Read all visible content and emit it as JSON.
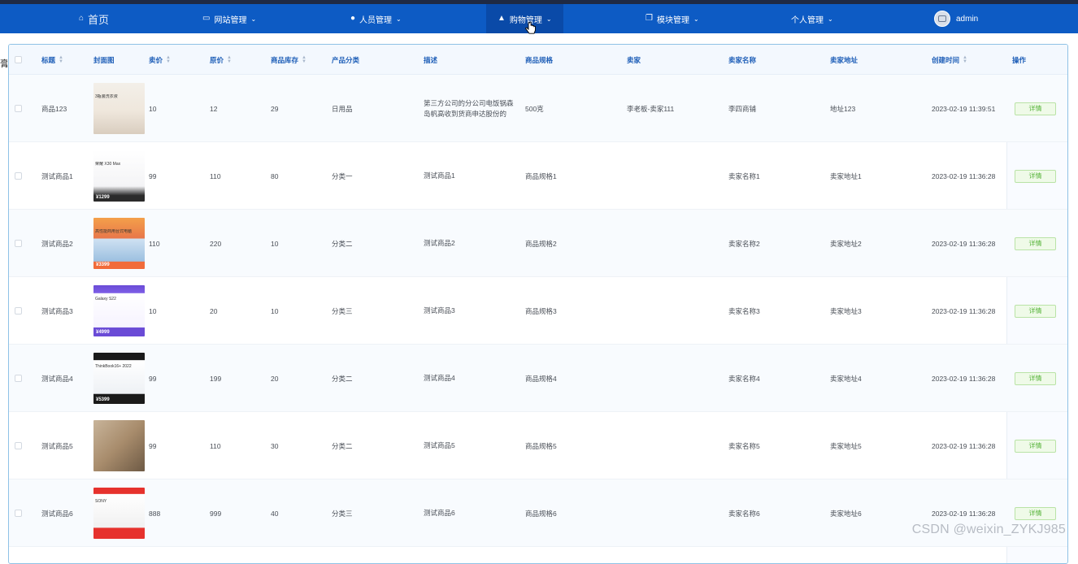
{
  "nav": {
    "home": "首页",
    "items": [
      {
        "label": "网站管理",
        "icon": "monitor-icon"
      },
      {
        "label": "人员管理",
        "icon": "user-icon"
      },
      {
        "label": "购物管理",
        "icon": "bag-icon"
      },
      {
        "label": "模块管理",
        "icon": "copy-icon"
      },
      {
        "label": "个人管理",
        "icon": ""
      }
    ],
    "user": "admin"
  },
  "left_char": "膏",
  "table": {
    "headers": [
      "标题",
      "封面图",
      "卖价",
      "原价",
      "商品库存",
      "产品分类",
      "描述",
      "商品规格",
      "卖家",
      "卖家名称",
      "卖家地址",
      "创建时间",
      "操作"
    ],
    "detail_label": "详情",
    "rows": [
      {
        "title": "商品123",
        "price": "10",
        "orig": "12",
        "stock": "29",
        "category": "日用品",
        "desc": "第三方公司的分公司电饭锅森岛帆高收到货商申达股份的",
        "spec": "500克",
        "seller": "李老板-卖家111",
        "seller_name": "李四商铺",
        "address": "地址123",
        "created": "2023-02-19 11:39:51"
      },
      {
        "title": "测试商品1",
        "price": "99",
        "orig": "110",
        "stock": "80",
        "category": "分类一",
        "desc": "测试商品1",
        "spec": "商品规格1",
        "seller": "",
        "seller_name": "卖家名称1",
        "address": "卖家地址1",
        "created": "2023-02-19 11:36:28"
      },
      {
        "title": "测试商品2",
        "price": "110",
        "orig": "220",
        "stock": "10",
        "category": "分类二",
        "desc": "测试商品2",
        "spec": "商品规格2",
        "seller": "",
        "seller_name": "卖家名称2",
        "address": "卖家地址2",
        "created": "2023-02-19 11:36:28"
      },
      {
        "title": "测试商品3",
        "price": "10",
        "orig": "20",
        "stock": "10",
        "category": "分类三",
        "desc": "测试商品3",
        "spec": "商品规格3",
        "seller": "",
        "seller_name": "卖家名称3",
        "address": "卖家地址3",
        "created": "2023-02-19 11:36:28"
      },
      {
        "title": "测试商品4",
        "price": "99",
        "orig": "199",
        "stock": "20",
        "category": "分类二",
        "desc": "测试商品4",
        "spec": "商品规格4",
        "seller": "",
        "seller_name": "卖家名称4",
        "address": "卖家地址4",
        "created": "2023-02-19 11:36:28"
      },
      {
        "title": "测试商品5",
        "price": "99",
        "orig": "110",
        "stock": "30",
        "category": "分类二",
        "desc": "测试商品5",
        "spec": "商品规格5",
        "seller": "",
        "seller_name": "卖家名称5",
        "address": "卖家地址5",
        "created": "2023-02-19 11:36:28"
      },
      {
        "title": "测试商品6",
        "price": "888",
        "orig": "999",
        "stock": "40",
        "category": "分类三",
        "desc": "测试商品6",
        "spec": "商品规格6",
        "seller": "",
        "seller_name": "卖家名称6",
        "address": "卖家地址6",
        "created": "2023-02-19 11:36:28"
      }
    ],
    "thumbs": [
      {
        "caption": "3瓶装洗衣液",
        "price_tag": ""
      },
      {
        "caption": "荣耀 X30 Max",
        "price_tag": "1299"
      },
      {
        "caption": "高性能商用台式电脑",
        "price_tag": "3399"
      },
      {
        "caption": "Galaxy S22",
        "price_tag": "4999"
      },
      {
        "caption": "ThinkBook16+ 2022",
        "price_tag": "5399"
      },
      {
        "caption": "",
        "price_tag": ""
      },
      {
        "caption": "SONY",
        "price_tag": ""
      }
    ]
  },
  "watermark": "CSDN @weixin_ZYKJ985"
}
